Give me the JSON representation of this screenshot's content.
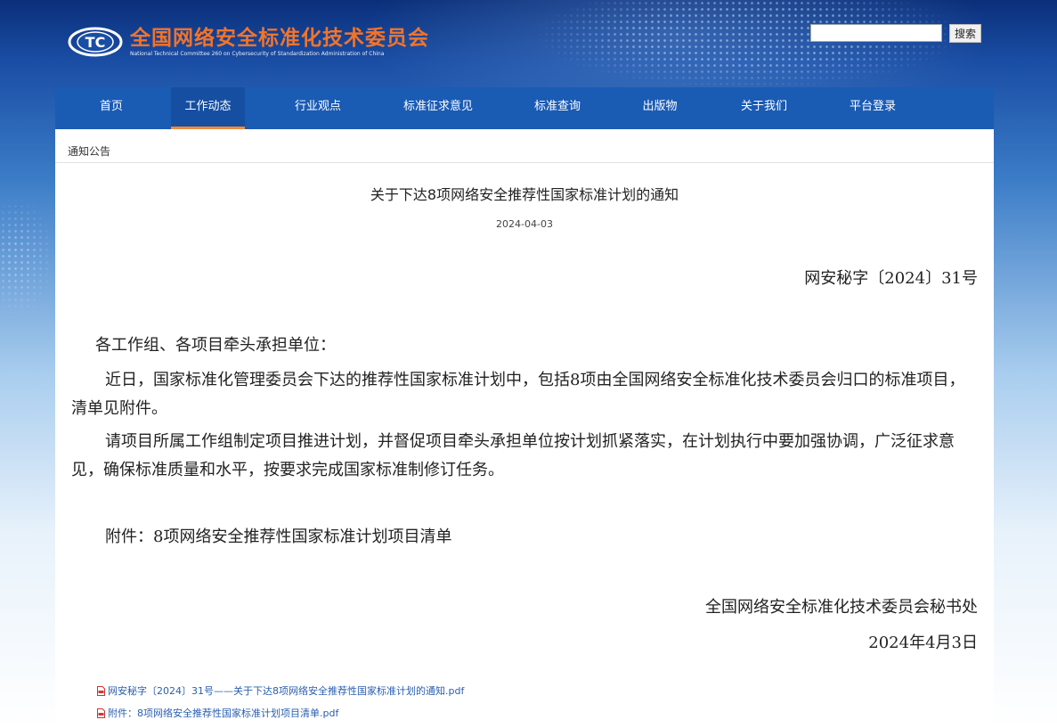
{
  "header": {
    "logo_cn": "全国网络安全标准化技术委员会",
    "logo_en": "National Technical Committee 260 on Cybersecurity of Standardization Administration of China",
    "logo_mark": "TC",
    "search_placeholder": "",
    "search_label": "搜索"
  },
  "nav": {
    "items": [
      {
        "label": "首页"
      },
      {
        "label": "工作动态"
      },
      {
        "label": "行业观点"
      },
      {
        "label": "标准征求意见"
      },
      {
        "label": "标准查询"
      },
      {
        "label": "出版物"
      },
      {
        "label": "关于我们"
      },
      {
        "label": "平台登录"
      }
    ],
    "active_index": 1
  },
  "breadcrumb": "通知公告",
  "article": {
    "title": "关于下达8项网络安全推荐性国家标准计划的通知",
    "date": "2024-04-03",
    "doc_number": "网安秘字〔2024〕31号",
    "salutation": "各工作组、各项目牵头承担单位：",
    "paragraph1": "近日，国家标准化管理委员会下达的推荐性国家标准计划中，包括8项由全国网络安全标准化技术委员会归口的标准项目，清单见附件。",
    "paragraph2": "请项目所属工作组制定项目推进计划，并督促项目牵头承担单位按计划抓紧落实，在计划执行中要加强协调，广泛征求意见，确保标准质量和水平，按要求完成国家标准制修订任务。",
    "attachment_note": "附件：8项网络安全推荐性国家标准计划项目清单",
    "signature_org": "全国网络安全标准化技术委员会秘书处",
    "signature_date": "2024年4月3日"
  },
  "attachments": [
    {
      "label": "网安秘字〔2024〕31号——关于下达8项网络安全推荐性国家标准计划的通知.pdf",
      "icon": "pdf-icon"
    },
    {
      "label": "附件：8项网络安全推荐性国家标准计划项目清单.pdf",
      "icon": "pdf-icon"
    }
  ],
  "colors": {
    "nav_bg": "#1a5bb4",
    "nav_active_underline": "#f08a3a",
    "logo_orange": "#f2742a",
    "link_blue": "#2a5fb0"
  }
}
